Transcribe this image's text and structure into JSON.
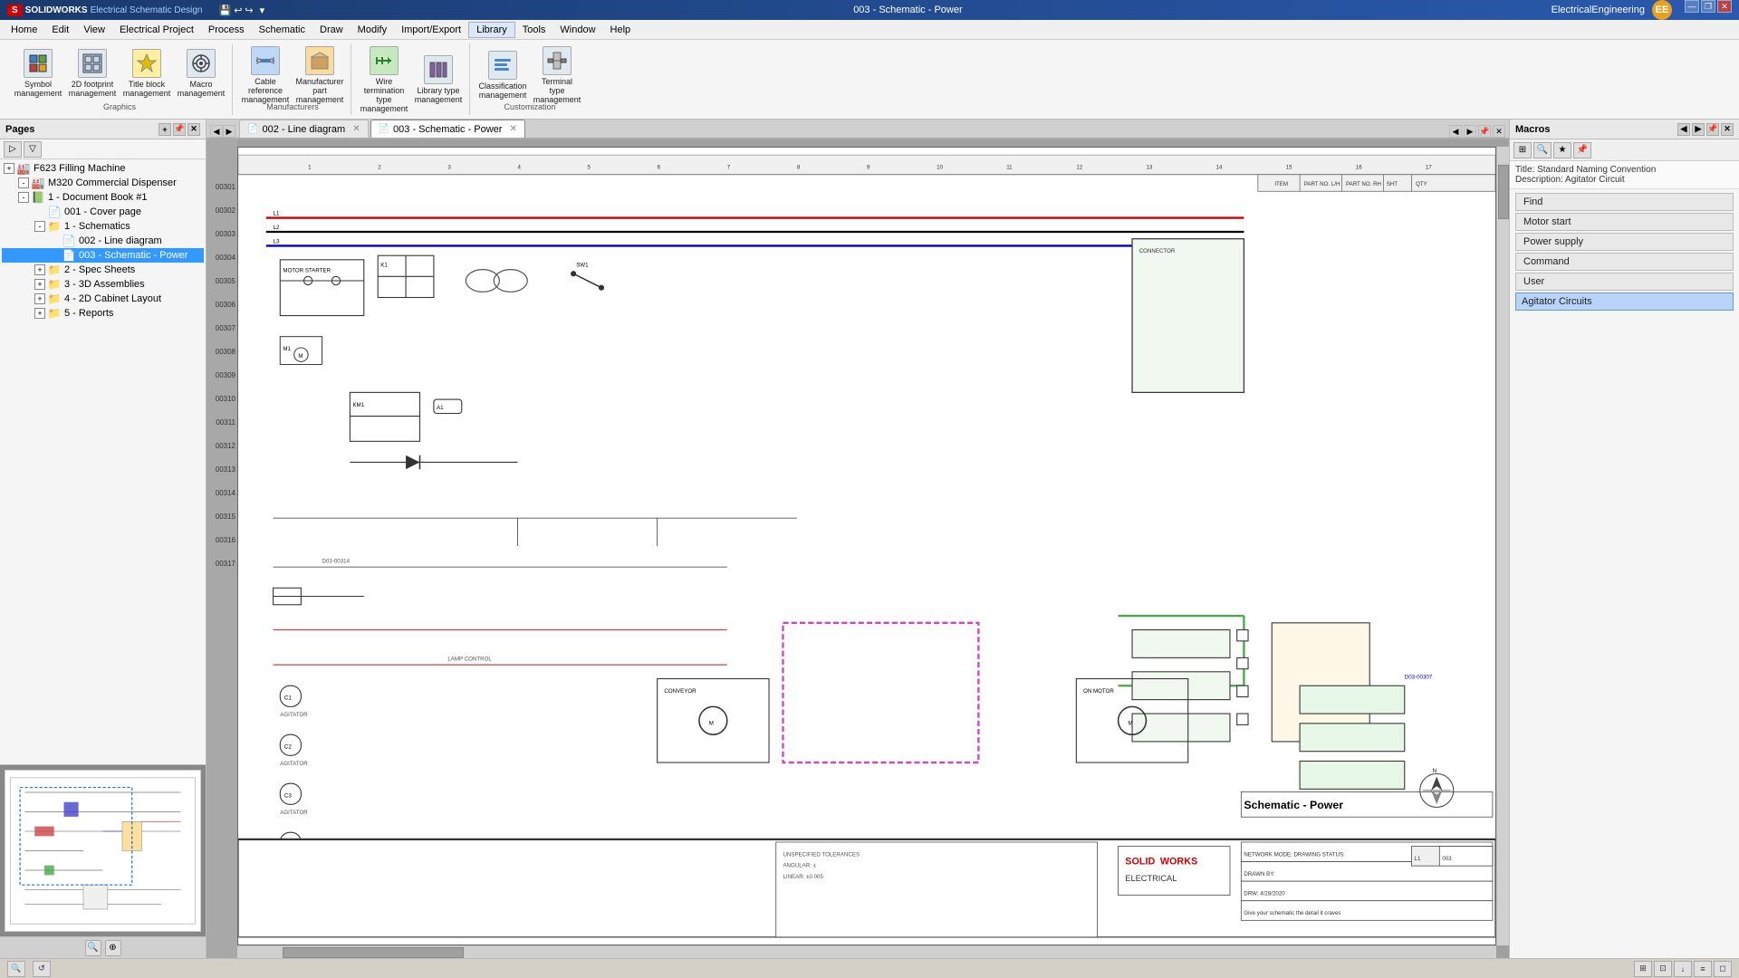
{
  "app": {
    "title": "003 - Schematic - Power",
    "logo_text": "SOLIDWORKS",
    "product_text": "Electrical Schematic Design"
  },
  "titlebar": {
    "title": "003 - Schematic - Power",
    "user": "EE",
    "workspace": "ElectricalEngineering",
    "minimize": "—",
    "restore": "❐",
    "close": "✕"
  },
  "menubar": {
    "items": [
      "Home",
      "Edit",
      "View",
      "Electrical Project",
      "Process",
      "Schematic",
      "Draw",
      "Modify",
      "Import/Export",
      "Library",
      "Tools",
      "Window",
      "Help"
    ]
  },
  "toolbar": {
    "groups": [
      {
        "label": "Graphics",
        "buttons": [
          {
            "id": "symbol-mgmt",
            "label": "Symbol management",
            "icon": "⬜"
          },
          {
            "id": "2d-footprint",
            "label": "2D footprint management",
            "icon": "▦"
          },
          {
            "id": "title-block",
            "label": "Title block management",
            "icon": "★"
          },
          {
            "id": "macro-mgmt",
            "label": "Macro management",
            "icon": "⚙"
          }
        ]
      },
      {
        "label": "Manufacturers",
        "buttons": [
          {
            "id": "cable-ref",
            "label": "Cable reference management",
            "icon": "🔌"
          },
          {
            "id": "mfr-part",
            "label": "Manufacturer part management",
            "icon": "📦"
          }
        ]
      },
      {
        "label": "",
        "buttons": [
          {
            "id": "wire-term",
            "label": "Wire termination type management",
            "icon": "⚡"
          },
          {
            "id": "library-type",
            "label": "Library type management",
            "icon": "📚"
          }
        ]
      },
      {
        "label": "Customization",
        "buttons": [
          {
            "id": "classification",
            "label": "Classification management",
            "icon": "📋"
          },
          {
            "id": "terminal-type",
            "label": "Terminal type management",
            "icon": "🔗"
          }
        ]
      }
    ]
  },
  "pages_panel": {
    "title": "Pages",
    "tree": [
      {
        "id": "f623",
        "label": "F623 Filling Machine",
        "level": 0,
        "expand": false,
        "type": "root"
      },
      {
        "id": "m320",
        "label": "M320 Commercial Dispenser",
        "level": 1,
        "expand": true,
        "type": "machine"
      },
      {
        "id": "doc1",
        "label": "1 - Document Book #1",
        "level": 2,
        "expand": true,
        "type": "book"
      },
      {
        "id": "cover",
        "label": "001 - Cover page",
        "level": 3,
        "expand": false,
        "type": "page"
      },
      {
        "id": "schematics",
        "label": "1 - Schematics",
        "level": 3,
        "expand": true,
        "type": "folder"
      },
      {
        "id": "line-diag",
        "label": "002 - Line diagram",
        "level": 4,
        "expand": false,
        "type": "page"
      },
      {
        "id": "sch-power",
        "label": "003 - Schematic - Power",
        "level": 4,
        "expand": false,
        "type": "page",
        "selected": true
      },
      {
        "id": "spec-sheets",
        "label": "2 - Spec Sheets",
        "level": 3,
        "expand": false,
        "type": "folder"
      },
      {
        "id": "3d-assemblies",
        "label": "3 - 3D Assemblies",
        "level": 3,
        "expand": false,
        "type": "folder"
      },
      {
        "id": "2d-cabinet",
        "label": "4 - 2D Cabinet Layout",
        "level": 3,
        "expand": false,
        "type": "folder"
      },
      {
        "id": "reports",
        "label": "5 - Reports",
        "level": 3,
        "expand": false,
        "type": "folder"
      }
    ]
  },
  "tabs": [
    {
      "id": "tab-line",
      "label": "002 - Line diagram",
      "active": false,
      "icon": "📄"
    },
    {
      "id": "tab-power",
      "label": "003 - Schematic - Power",
      "active": true,
      "icon": "📄"
    }
  ],
  "schematic": {
    "row_numbers": [
      "00301",
      "00302",
      "00303",
      "00304",
      "00305",
      "00306",
      "00307",
      "00308",
      "00309",
      "00310",
      "00311",
      "00312",
      "00313",
      "00314",
      "00315",
      "00316",
      "00317"
    ]
  },
  "macros_panel": {
    "title": "Macros",
    "info_title": "Title: Standard Naming Convention",
    "info_desc": "Description: Agitator Circuit",
    "buttons": [
      {
        "id": "find",
        "label": "Find"
      },
      {
        "id": "motor-start",
        "label": "Motor start"
      },
      {
        "id": "power-supply",
        "label": "Power supply"
      },
      {
        "id": "command",
        "label": "Command"
      },
      {
        "id": "user",
        "label": "User"
      },
      {
        "id": "agitator",
        "label": "Agitator Circuits",
        "selected": true
      }
    ]
  },
  "statusbar": {
    "text": ""
  }
}
